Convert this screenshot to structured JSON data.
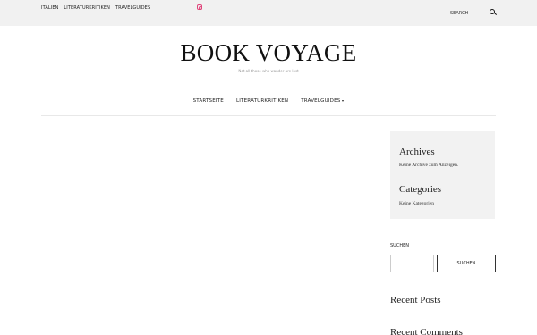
{
  "topbar": {
    "nav": [
      "ITALIEN",
      "LITERATURKRITIKEN",
      "TRAVELGUIDES"
    ],
    "instagram_icon": "instagram-icon",
    "search_label": "SEARCH",
    "search_icon": "search-icon"
  },
  "site": {
    "title": "BOOK VOYAGE",
    "tagline": "Not all those who wander are lost"
  },
  "main_nav": {
    "items": [
      "STARTSEITE",
      "LITERATURKRITIKEN",
      "TRAVELGUIDES"
    ]
  },
  "sidebar": {
    "archives_title": "Archives",
    "archives_text": "Keine Archive zum Anzeigen.",
    "categories_title": "Categories",
    "categories_text": "Keine Kategorien",
    "search_label": "SUCHEN",
    "search_input_value": "",
    "search_button": "SUCHEN",
    "recent_posts_title": "Recent Posts",
    "recent_comments_title": "Recent Comments"
  },
  "colors": {
    "topbar_bg": "#f1f1f1",
    "instagram": "#e0457b",
    "widget_bg": "#f2f2f2"
  }
}
